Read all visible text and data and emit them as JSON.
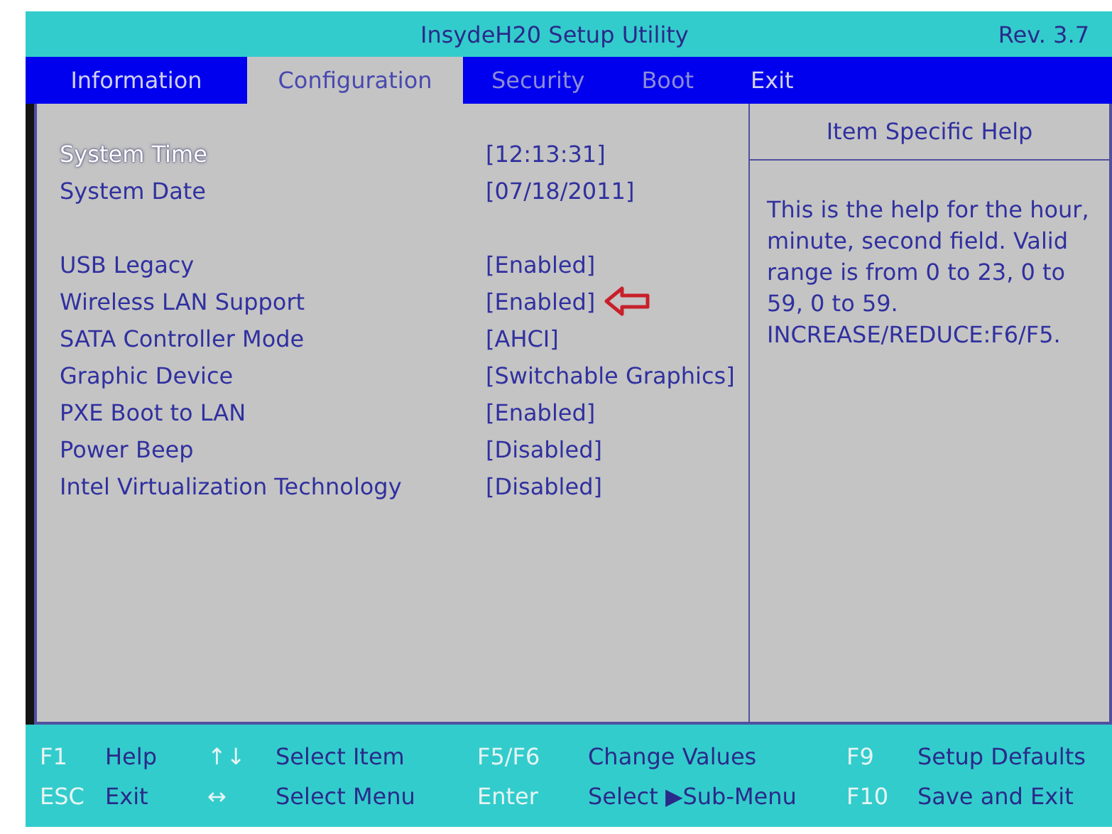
{
  "window": {
    "title": "InsydeH20 Setup Utility",
    "revision": "Rev. 3.7"
  },
  "tabs": [
    {
      "label": "Information",
      "selected": false,
      "dimmed": false
    },
    {
      "label": "Configuration",
      "selected": true,
      "dimmed": false
    },
    {
      "label": "Security",
      "selected": false,
      "dimmed": true
    },
    {
      "label": "Boot",
      "selected": false,
      "dimmed": true
    },
    {
      "label": "Exit",
      "selected": false,
      "dimmed": false
    }
  ],
  "settings": [
    [
      {
        "label": "System Time",
        "value": "[12:13:31]",
        "selected": true,
        "pointed": false
      },
      {
        "label": "System Date",
        "value": "[07/18/2011]",
        "selected": false,
        "pointed": false
      }
    ],
    [
      {
        "label": "USB Legacy",
        "value": "[Enabled]",
        "selected": false,
        "pointed": false
      },
      {
        "label": "Wireless LAN Support",
        "value": "[Enabled]",
        "selected": false,
        "pointed": true
      },
      {
        "label": "SATA Controller Mode",
        "value": "[AHCI]",
        "selected": false,
        "pointed": false
      },
      {
        "label": "Graphic Device",
        "value": "[Switchable Graphics]",
        "selected": false,
        "pointed": false
      },
      {
        "label": "PXE Boot to LAN",
        "value": "[Enabled]",
        "selected": false,
        "pointed": false
      },
      {
        "label": "Power Beep",
        "value": "[Disabled]",
        "selected": false,
        "pointed": false
      },
      {
        "label": "Intel Virtualization Technology",
        "value": "[Disabled]",
        "selected": false,
        "pointed": false
      }
    ]
  ],
  "help": {
    "title": "Item Specific Help",
    "text": "This is the help for the hour, minute, second field. Valid range is from 0 to 23, 0 to 59, 0 to 59. INCREASE/REDUCE:F6/F5."
  },
  "footer": [
    [
      {
        "key": "F1",
        "action": "Help"
      },
      {
        "key": "↑↓",
        "action": "Select Item"
      },
      {
        "key": "F5/F6",
        "action": "Change Values"
      },
      {
        "key": "F9",
        "action": "Setup Defaults"
      }
    ],
    [
      {
        "key": "ESC",
        "action": "Exit"
      },
      {
        "key": "↔",
        "action": "Select Menu"
      },
      {
        "key": "Enter",
        "action": "Select ▶Sub-Menu"
      },
      {
        "key": "F10",
        "action": "Save and Exit"
      }
    ]
  ]
}
